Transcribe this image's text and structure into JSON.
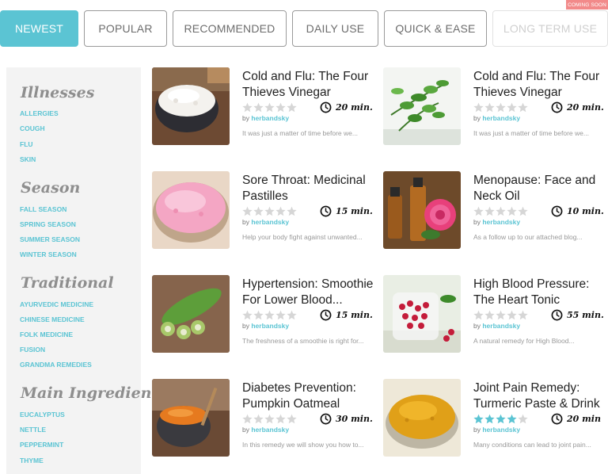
{
  "tabs": [
    {
      "label": "NEWEST",
      "state": "active"
    },
    {
      "label": "POPULAR",
      "state": "normal"
    },
    {
      "label": "RECOMMENDED",
      "state": "normal"
    },
    {
      "label": "DAILY USE",
      "state": "normal"
    },
    {
      "label": "QUICK & EASE",
      "state": "normal"
    },
    {
      "label": "LONG TERM USE",
      "state": "disabled"
    }
  ],
  "coming_soon_badge": "COMING SOON",
  "sidebar": {
    "categories": [
      {
        "title": "Illnesses",
        "links": [
          "ALLERGIES",
          "COUGH",
          "FLU",
          "SKIN"
        ]
      },
      {
        "title": "Season",
        "links": [
          "FALL SEASON",
          "SPRING SEASON",
          "SUMMER SEASON",
          "WINTER SEASON"
        ]
      },
      {
        "title": "Traditional",
        "links": [
          "AYURVEDIC MEDICINE",
          "CHINESE MEDICINE",
          "FOLK MEDICINE",
          "FUSION",
          "GRANDMA REMEDIES"
        ]
      },
      {
        "title": "Main Ingredient",
        "links": [
          "EUCALYPTUS",
          "NETTLE",
          "PEPPERMINT",
          "THYME"
        ]
      }
    ]
  },
  "recipes": [
    {
      "title": "Cold and Flu: The Four Thieves Vinegar",
      "time": "20 min.",
      "by": "by",
      "author": "herbandsky",
      "excerpt": "It was just a matter of time before we...",
      "rating": 0,
      "image": "flour-bowl"
    },
    {
      "title": "Cold and Flu: The Four Thieves Vinegar",
      "time": "20 min.",
      "by": "by",
      "author": "herbandsky",
      "excerpt": "It was just a matter of time before we...",
      "rating": 0,
      "image": "rue-herb"
    },
    {
      "title": "Sore Throat: Medicinal Pastilles",
      "time": "15 min.",
      "by": "by",
      "author": "herbandsky",
      "excerpt": "Help your body fight against unwanted...",
      "rating": 0,
      "image": "pink-powder-bowl"
    },
    {
      "title": "Menopause: Face and Neck Oil",
      "time": "10 min.",
      "by": "by",
      "author": "herbandsky",
      "excerpt": "As a follow up to our attached blog...",
      "rating": 0,
      "image": "rose-oil-bottles"
    },
    {
      "title": "Hypertension: Smoothie For Lower Blood...",
      "time": "15 min.",
      "by": "by",
      "author": "herbandsky",
      "excerpt": "The freshness of a smoothie is right for...",
      "rating": 0,
      "image": "bitter-melon"
    },
    {
      "title": "High Blood Pressure: The Heart Tonic",
      "time": "55 min.",
      "by": "by",
      "author": "herbandsky",
      "excerpt": "A natural remedy for High Blood...",
      "rating": 0,
      "image": "berries-jar"
    },
    {
      "title": "Diabetes Prevention: Pumpkin Oatmeal",
      "time": "30 min.",
      "by": "by",
      "author": "herbandsky",
      "excerpt": "In this remedy we will show you how to...",
      "rating": 0,
      "image": "pumpkin-mug"
    },
    {
      "title": "Joint Pain Remedy: Turmeric Paste & Drink",
      "time": "20 min",
      "by": "by",
      "author": "herbandsky",
      "excerpt": "Many conditions can lead to joint pain...",
      "rating": 4,
      "image": "turmeric-bowl"
    }
  ],
  "colors": {
    "accent": "#5bc4d3",
    "star_empty": "#d6d6d6",
    "star_filled": "#5bc4d3",
    "badge": "#f28a8a"
  }
}
